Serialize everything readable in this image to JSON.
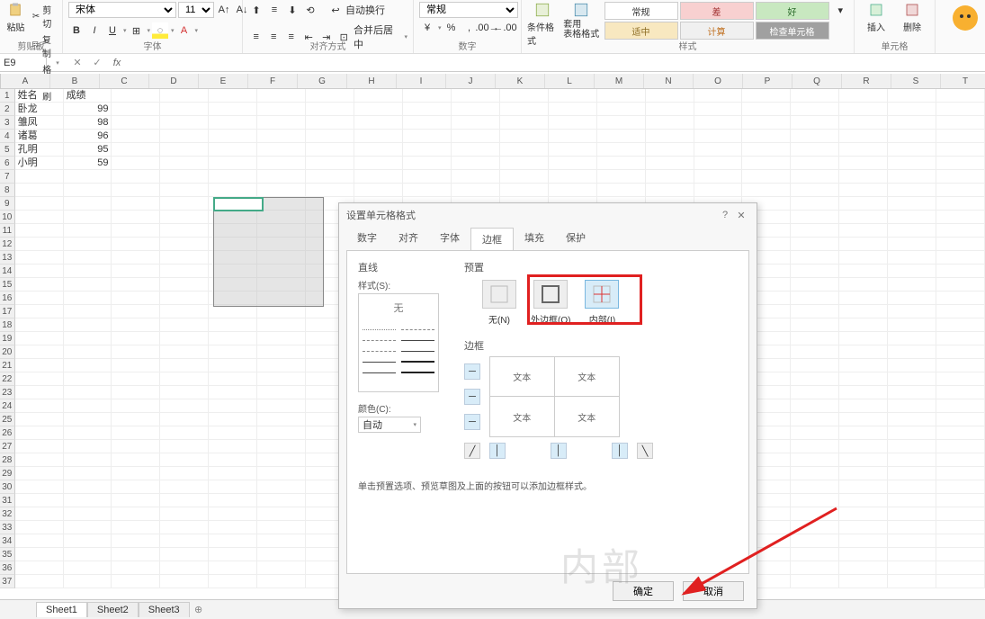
{
  "ribbon": {
    "clipboard": {
      "label": "剪贴板",
      "paste": "粘贴",
      "cut": "剪切",
      "copy": "复制",
      "format_painter": "格式刷"
    },
    "font": {
      "label": "字体",
      "name": "宋体",
      "size": "11",
      "bold": "B",
      "italic": "I",
      "underline": "U"
    },
    "align": {
      "label": "对齐方式",
      "wrap": "自动换行",
      "merge": "合并后居中"
    },
    "number": {
      "label": "数字",
      "format": "常规",
      "percent": "%",
      "comma": ","
    },
    "styles": {
      "label": "样式",
      "cond_format": "条件格式",
      "table_format": "套用\n表格格式",
      "chip_normal": "常规",
      "chip_bad": "差",
      "chip_good": "好",
      "chip_neutral": "适中",
      "chip_calc": "计算",
      "chip_check": "检查单元格"
    },
    "cells": {
      "label": "单元格",
      "insert": "插入",
      "delete": "删除"
    }
  },
  "formula_bar": {
    "name_box": "E9",
    "fx": "fx"
  },
  "columns": [
    "A",
    "B",
    "C",
    "D",
    "E",
    "F",
    "G",
    "H",
    "I",
    "J",
    "K",
    "L",
    "M",
    "N",
    "O",
    "P",
    "Q",
    "R",
    "S",
    "T"
  ],
  "data": {
    "headers": [
      "姓名",
      "成绩"
    ],
    "rows": [
      {
        "name": "卧龙",
        "score": "99"
      },
      {
        "name": "雏凤",
        "score": "98"
      },
      {
        "name": "诸葛",
        "score": "96"
      },
      {
        "name": "孔明",
        "score": "95"
      },
      {
        "name": "小明",
        "score": "59"
      }
    ]
  },
  "sheets": {
    "tabs": [
      "Sheet1",
      "Sheet2",
      "Sheet3"
    ],
    "active": 0
  },
  "dialog": {
    "title": "设置单元格格式",
    "tabs": [
      "数字",
      "对齐",
      "字体",
      "边框",
      "填充",
      "保护"
    ],
    "active_tab": 3,
    "line_section": "直线",
    "style_label": "样式(S):",
    "style_none": "无",
    "color_label": "颜色(C):",
    "color_auto": "自动",
    "preset_section": "预置",
    "preset_none": "无(N)",
    "preset_outline": "外边框(O)",
    "preset_inside": "内部(I)",
    "border_section": "边框",
    "preview_text": "文本",
    "hint": "单击预置选项、预览草图及上面的按钮可以添加边框样式。",
    "ok": "确定",
    "cancel": "取消"
  },
  "watermark": "内部"
}
